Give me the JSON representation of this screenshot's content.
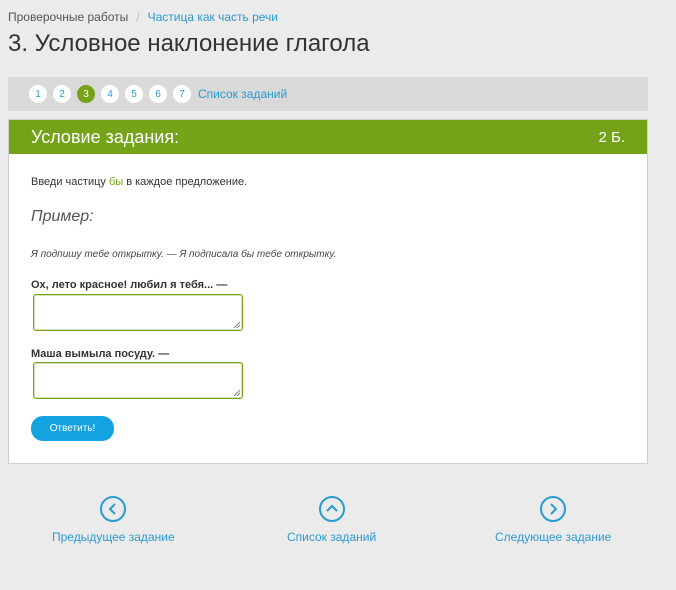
{
  "breadcrumb": {
    "root": "Проверочные работы",
    "separator": "/",
    "current": "Частица как часть речи"
  },
  "page_title": "3. Условное наклонение глагола",
  "pager": {
    "numbers": [
      "1",
      "2",
      "3",
      "4",
      "5",
      "6",
      "7"
    ],
    "active": "3",
    "list_label": "Список заданий"
  },
  "panel": {
    "title": "Условие задания:",
    "score": "2 Б.",
    "instruction_before": "Введи частицу ",
    "instruction_highlight": "бы",
    "instruction_after": " в каждое предложение.",
    "example_heading": "Пример:",
    "example_text": "Я подпишу тебе открытку. — Я подписала бы тебе открытку.",
    "questions": [
      {
        "label": "Ох, лето красное! любил я тебя... —",
        "value": ""
      },
      {
        "label": "Маша вымыла посуду. —",
        "value": ""
      }
    ],
    "submit_label": "Ответить!"
  },
  "nav": {
    "prev": "Предыдущее задание",
    "list": "Список заданий",
    "next": "Следующее задание"
  },
  "colors": {
    "accent_green": "#74a319",
    "link_blue": "#2a9bd1",
    "button_blue": "#12a3e0"
  }
}
